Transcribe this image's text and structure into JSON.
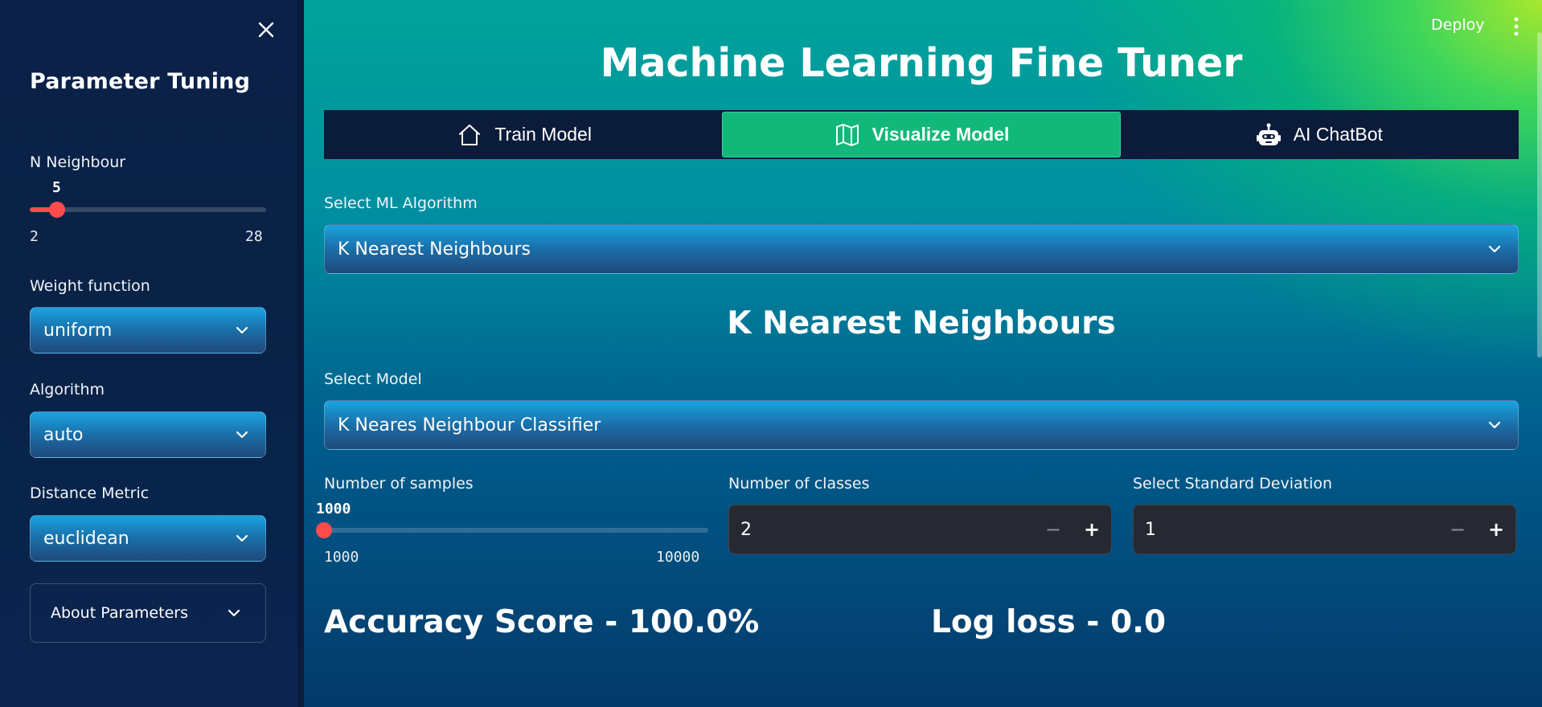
{
  "sidebar": {
    "title": "Parameter Tuning",
    "n_neighbour": {
      "label": "N Neighbour",
      "value": 5,
      "value_text": "5",
      "min": 2,
      "max": 28,
      "min_text": "2",
      "max_text": "28"
    },
    "weight_function": {
      "label": "Weight function",
      "selected": "uniform"
    },
    "algorithm": {
      "label": "Algorithm",
      "selected": "auto"
    },
    "distance_metric": {
      "label": "Distance Metric",
      "selected": "euclidean"
    },
    "about": {
      "label": "About Parameters"
    }
  },
  "header": {
    "deploy_label": "Deploy"
  },
  "main": {
    "title": "Machine Learning Fine Tuner",
    "tabs": [
      {
        "label": "Train Model",
        "icon": "home-icon",
        "active": false
      },
      {
        "label": "Visualize Model",
        "icon": "map-icon",
        "active": true
      },
      {
        "label": "AI ChatBot",
        "icon": "robot-icon",
        "active": false
      }
    ],
    "algorithm_select": {
      "label": "Select ML Algorithm",
      "selected": "K Nearest Neighbours"
    },
    "section_title": "K Nearest Neighbours",
    "model_select": {
      "label": "Select Model",
      "selected": "K Neares Neighbour Classifier"
    },
    "samples": {
      "label": "Number of samples",
      "value": 1000,
      "value_text": "1000",
      "min": 1000,
      "max": 10000,
      "min_text": "1000",
      "max_text": "10000"
    },
    "classes": {
      "label": "Number of classes",
      "value": "2"
    },
    "std_dev": {
      "label": "Select Standard Deviation",
      "value": "1"
    },
    "accuracy": "Accuracy Score - 100.0%",
    "log_loss": "Log loss - 0.0"
  },
  "colors": {
    "accent": "#ff4b4b",
    "tab_active": "#12b87a",
    "tab_bar": "#0b1b3a",
    "input_bg": "#262932"
  }
}
